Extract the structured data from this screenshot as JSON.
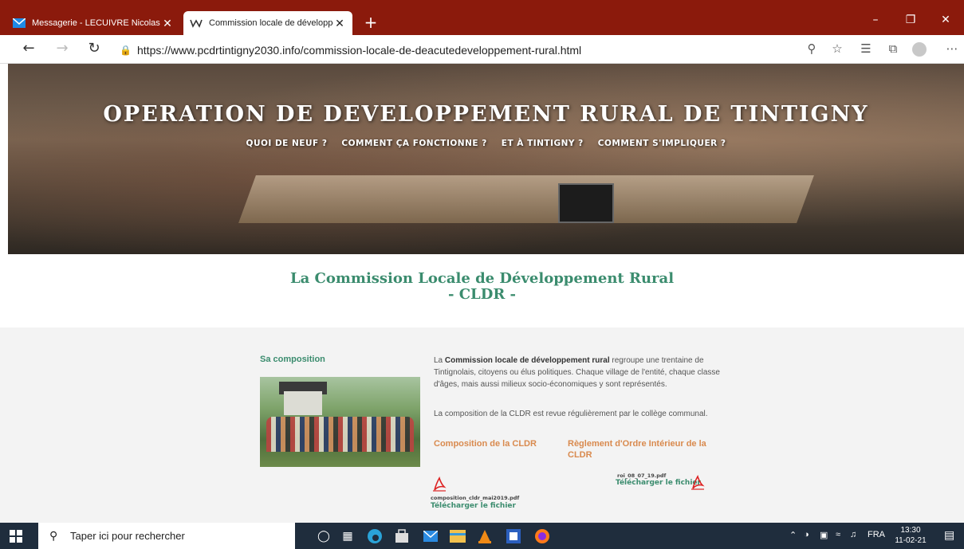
{
  "browser": {
    "tabs": [
      {
        "label": "Messagerie - LECUIVRE Nicolas -",
        "close": "✕"
      },
      {
        "label": "Commission locale de développe",
        "close": "✕"
      }
    ],
    "new_tab": "+",
    "url": "https://www.pcdrtintigny2030.info/commission-locale-de-deacutedeveloppement-rural.html"
  },
  "site": {
    "title": "OPERATION DE DEVELOPPEMENT RURAL DE TINTIGNY",
    "nav": [
      "QUOI DE NEUF ?",
      "COMMENT ÇA FONCTIONNE ?",
      "ET À TINTIGNY ?",
      "COMMENT S'IMPLIQUER ?"
    ]
  },
  "page": {
    "title_line1": "La Commission Locale de Développement Rural",
    "title_line2": "- CLDR -",
    "section_heading": "Sa composition",
    "para1_bold": "Commission locale de développement rural",
    "para1_pre": "La ",
    "para1_post": " regroupe une trentaine de Tintignolais, citoyens ou élus politiques. Chaque village de l'entité, chaque classe d'âges, mais aussi milieux socio-économiques y sont représentés.",
    "para2": "La composition de la CLDR est revue régulièrement par le collège communal.",
    "downloads": [
      {
        "title": "Composition de la CLDR",
        "filename": "composition_cldr_mai2019.pdf",
        "link": "Télécharger le fichier"
      },
      {
        "title": "Règlement d'Ordre Intérieur de la CLDR",
        "filename": "roi_08_07_19.pdf",
        "link": "Télécharger le fichier"
      }
    ]
  },
  "taskbar": {
    "search_placeholder": "Taper ici pour rechercher",
    "language": "FRA",
    "time": "13:30",
    "date": "11-02-21"
  },
  "colors": {
    "tab_bar": "#8b1a0c",
    "accent_green": "#3b8c6e",
    "accent_orange": "#d98a4e",
    "taskbar": "#1f2d3d"
  }
}
